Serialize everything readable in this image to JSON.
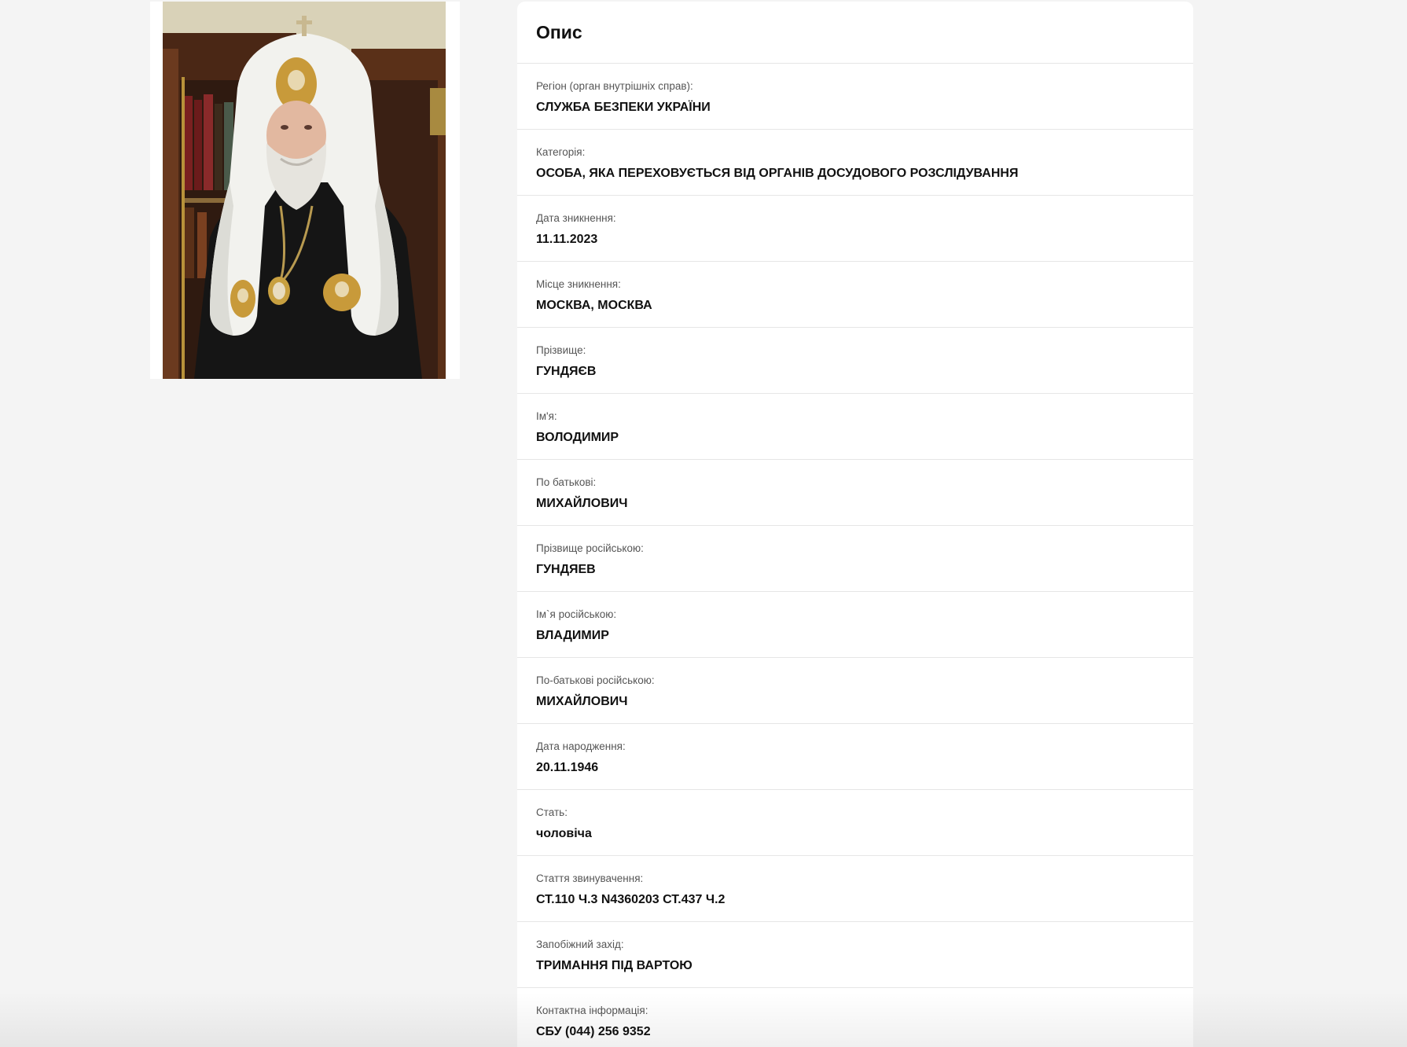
{
  "photo": {
    "description_name": "portrait-photo"
  },
  "description": {
    "title": "Опис",
    "fields": [
      {
        "label": "Регіон (орган внутрішніх справ):",
        "value": "СЛУЖБА БЕЗПЕКИ УКРАЇНИ"
      },
      {
        "label": "Категорія:",
        "value": "ОСОБА, ЯКА ПЕРЕХОВУЄТЬСЯ ВІД ОРГАНІВ ДОСУДОВОГО РОЗСЛІДУВАННЯ"
      },
      {
        "label": "Дата зникнення:",
        "value": "11.11.2023"
      },
      {
        "label": "Місце зникнення:",
        "value": "МОСКВА, МОСКВА"
      },
      {
        "label": "Прізвище:",
        "value": "ГУНДЯЄВ"
      },
      {
        "label": "Ім'я:",
        "value": "ВОЛОДИМИР"
      },
      {
        "label": "По батькові:",
        "value": "МИХАЙЛОВИЧ"
      },
      {
        "label": "Прізвище російською:",
        "value": "ГУНДЯЕВ"
      },
      {
        "label": "Ім`я російською:",
        "value": "ВЛАДИМИР"
      },
      {
        "label": "По-батькові російською:",
        "value": "МИХАЙЛОВИЧ"
      },
      {
        "label": "Дата народження:",
        "value": "20.11.1946"
      },
      {
        "label": "Стать:",
        "value": "чоловіча"
      },
      {
        "label": "Стаття звинувачення:",
        "value": "СТ.110 Ч.3 N4360203 СТ.437 Ч.2"
      },
      {
        "label": "Запобіжний захід:",
        "value": "ТРИМАННЯ ПІД ВАРТОЮ"
      },
      {
        "label": "Контактна інформація:",
        "value": "СБУ (044) 256 9352"
      }
    ]
  },
  "colors": {
    "page_background": "#f4f4f4",
    "panel_background": "#ffffff",
    "divider": "#e6e6e6",
    "label_text": "#555555",
    "value_text": "#111111"
  }
}
